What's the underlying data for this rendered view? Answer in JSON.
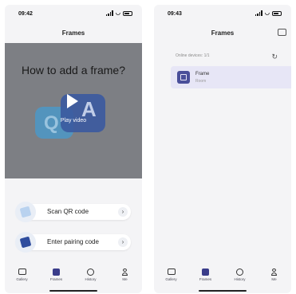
{
  "left": {
    "time": "09:42",
    "title": "Frames",
    "hero_title": "How to add a frame?",
    "hero_play_label": "Play video",
    "bubble_q": "Q",
    "bubble_a": "A",
    "options": [
      {
        "label": "Scan QR code",
        "icon": "qr-scan-icon"
      },
      {
        "label": "Enter pairing code",
        "icon": "pairing-code-icon"
      }
    ]
  },
  "right": {
    "time": "09:43",
    "title": "Frames",
    "online_devices": "Online devices: 1/1",
    "device": {
      "name": "Frame",
      "status": "Room"
    }
  },
  "tabs": [
    {
      "label": "Gallery",
      "icon": "gallery-icon"
    },
    {
      "label": "Frames",
      "icon": "frames-icon",
      "active": true
    },
    {
      "label": "History",
      "icon": "history-icon"
    },
    {
      "label": "Me",
      "icon": "me-icon"
    }
  ],
  "colors": {
    "accent": "#3a3d8a",
    "hero_overlay": "#7d7f84",
    "device_card": "#e7e6f6"
  }
}
